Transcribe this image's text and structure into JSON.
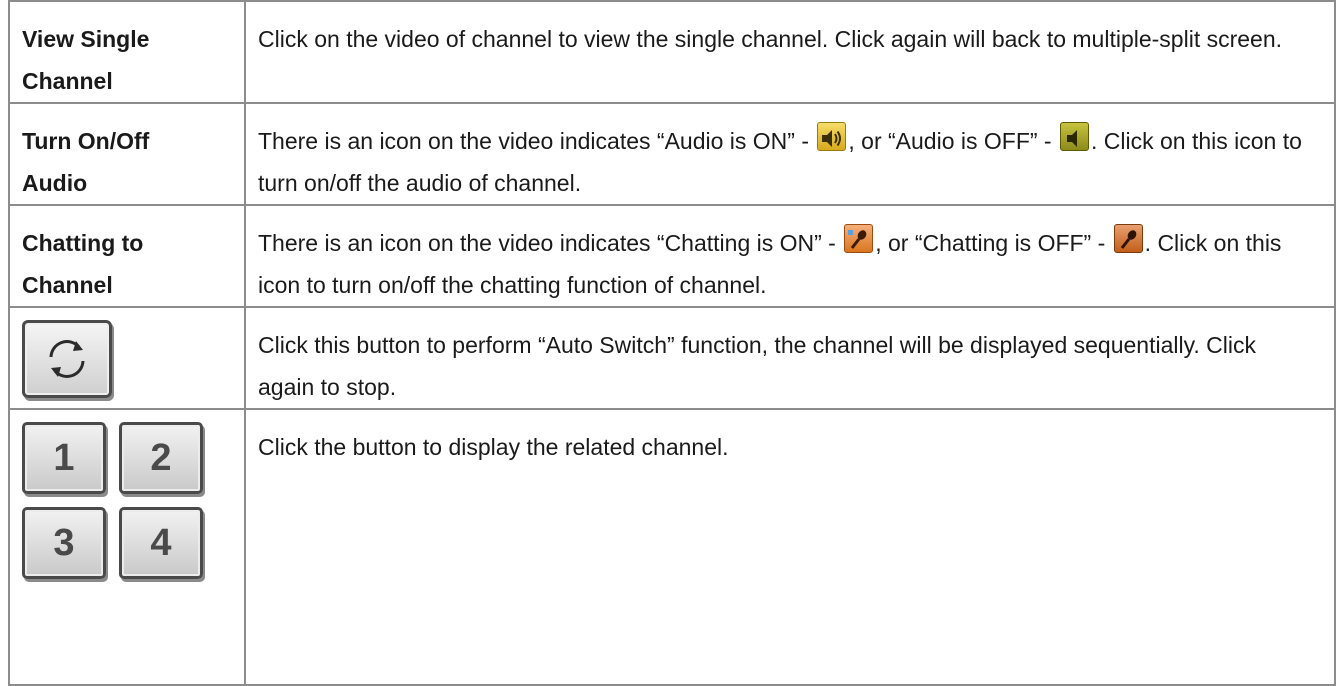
{
  "rows": [
    {
      "term": [
        "View Single",
        "Channel"
      ],
      "desc": "Click on the video of channel to view the single channel. Click again will back to multiple-split screen."
    },
    {
      "term": [
        "Turn On/Off",
        "Audio"
      ],
      "desc_a": "There is an icon on the video indicates “Audio is ON” - ",
      "desc_b": ", or “Audio is OFF” - ",
      "desc_c": ". Click on this icon to turn on/off the audio of channel."
    },
    {
      "term": [
        "Chatting to",
        "Channel"
      ],
      "desc_a": "There is an icon on the video indicates “Chatting is ON” - ",
      "desc_b": ", or “Chatting is OFF” - ",
      "desc_c": ". Click on this icon to turn on/off the chatting function of channel."
    },
    {
      "desc": "Click this button to perform “Auto Switch” function, the channel will be displayed sequentially. Click again to stop."
    },
    {
      "buttons": [
        "1",
        "2",
        "3",
        "4"
      ],
      "desc": "Click the button to display the related channel."
    }
  ],
  "icons": {
    "audio_on": "speaker-on-icon",
    "audio_off": "speaker-off-icon",
    "chat_on": "microphone-on-icon",
    "chat_off": "microphone-off-icon",
    "auto_switch": "refresh-icon"
  }
}
